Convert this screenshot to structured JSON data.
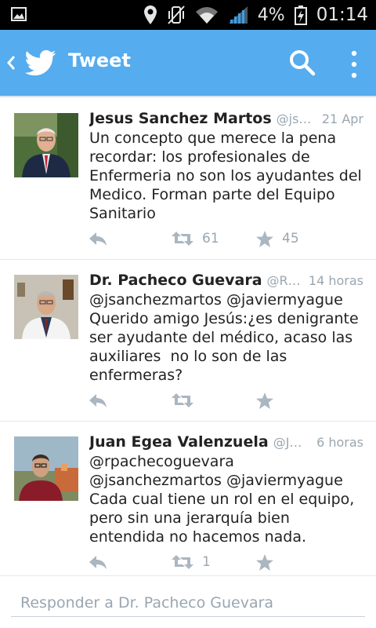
{
  "status_bar": {
    "battery": "4%",
    "time": "01:14",
    "icons": [
      "image-icon",
      "location-icon",
      "vibrate-icon",
      "wifi-icon",
      "signal-icon",
      "battery-icon"
    ]
  },
  "action_bar": {
    "title": "Tweet",
    "color": "#55acee",
    "icons": [
      "back-arrow-icon",
      "twitter-bird-icon",
      "search-icon",
      "overflow-menu-icon"
    ]
  },
  "tweets": [
    {
      "name": "Jesus Sanchez Martos",
      "handle": "@jsanchezmartos",
      "time": "21 Apr",
      "text": "Un concepto que merece la pena recordar: los profesionales de Enfermeria no son los ayudantes del Medico. Forman parte del Equipo Sanitario",
      "retweets": "61",
      "favorites": "45"
    },
    {
      "name": "Dr. Pacheco Guevara",
      "handle": "@RPachecoGuevara",
      "time": "14 horas",
      "text": "@jsanchezmartos @javiermyague Querido amigo Jesús:¿es denigrante ser ayudante del médico, acaso las auxiliares  no lo son de las enfermeras?",
      "retweets": "",
      "favorites": ""
    },
    {
      "name": "Juan Egea Valenzuela",
      "handle": "@JuanEgeaValenzuela",
      "time": "6 horas",
      "text": "@rpachecoguevara @jsanchezmartos @javiermyague Cada cual tiene un rol en el equipo, pero sin una jerarquía bien entendida no hacemos nada.",
      "retweets": "1",
      "favorites": ""
    }
  ],
  "reply": {
    "placeholder": "Responder a Dr. Pacheco Guevara"
  }
}
